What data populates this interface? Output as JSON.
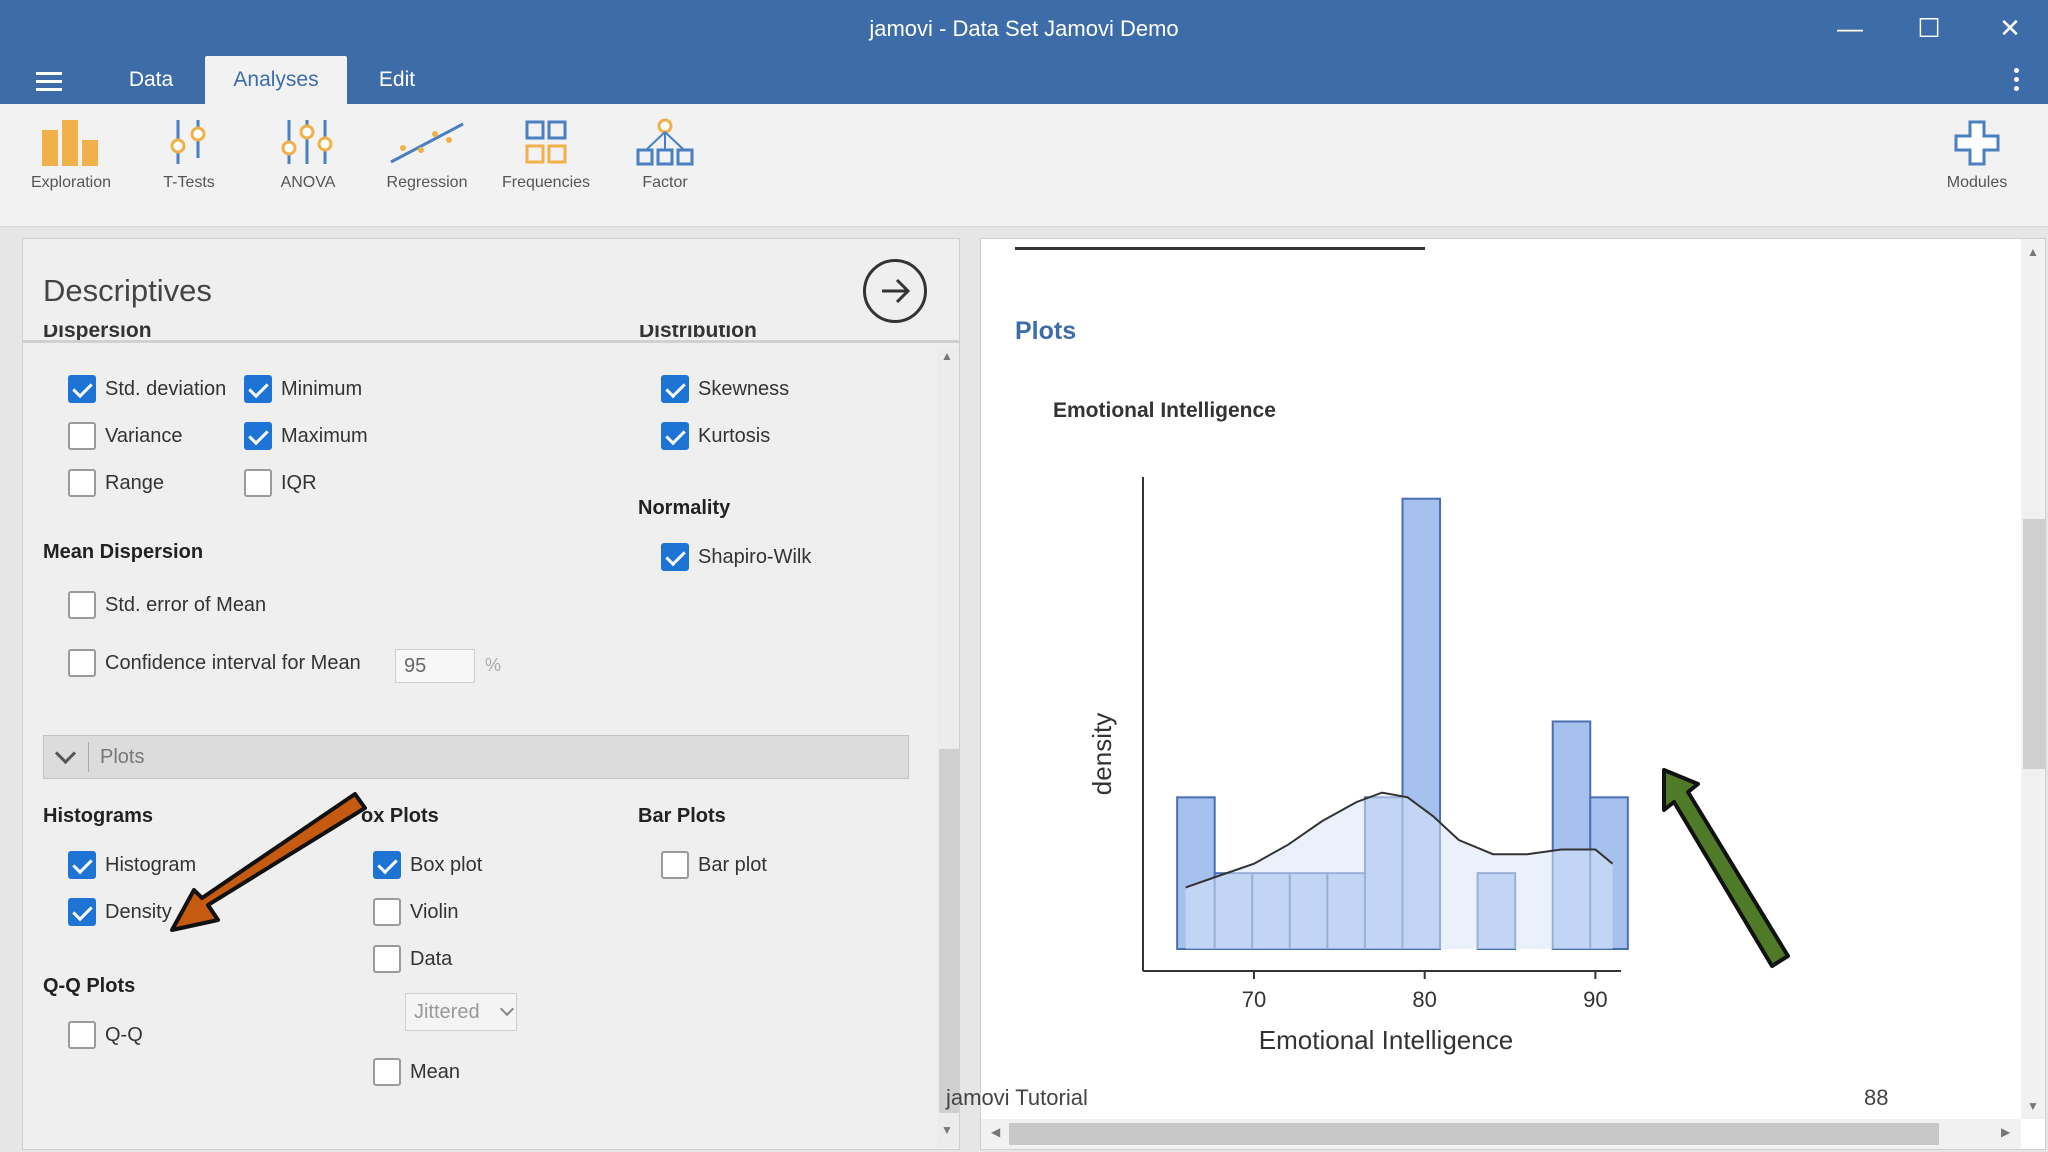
{
  "window": {
    "title": "jamovi - Data Set Jamovi Demo",
    "minimize": "—",
    "maximize": "☐",
    "close": "✕"
  },
  "menu": {
    "tabs": [
      {
        "label": "Data"
      },
      {
        "label": "Analyses"
      },
      {
        "label": "Edit"
      }
    ]
  },
  "ribbon": {
    "items": [
      {
        "label": "Exploration"
      },
      {
        "label": "T-Tests"
      },
      {
        "label": "ANOVA"
      },
      {
        "label": "Regression"
      },
      {
        "label": "Frequencies"
      },
      {
        "label": "Factor"
      }
    ],
    "modules": {
      "label": "Modules"
    }
  },
  "options": {
    "title": "Descriptives",
    "cut_headers": {
      "dispersion": "Dispersion",
      "distribution": "Distribution"
    },
    "dispersion": [
      {
        "label": "Std. deviation",
        "checked": true
      },
      {
        "label": "Minimum",
        "checked": true
      },
      {
        "label": "Variance",
        "checked": false
      },
      {
        "label": "Maximum",
        "checked": true
      },
      {
        "label": "Range",
        "checked": false
      },
      {
        "label": "IQR",
        "checked": false
      }
    ],
    "distribution": [
      {
        "label": "Skewness",
        "checked": true
      },
      {
        "label": "Kurtosis",
        "checked": true
      }
    ],
    "normality": {
      "title": "Normality",
      "items": [
        {
          "label": "Shapiro-Wilk",
          "checked": true
        }
      ]
    },
    "mean_dispersion": {
      "title": "Mean Dispersion",
      "items": [
        {
          "label": "Std. error of Mean",
          "checked": false
        },
        {
          "label": "Confidence interval for Mean",
          "checked": false
        }
      ],
      "ci_value": "95",
      "ci_unit": "%"
    },
    "plots_section": {
      "label": "Plots"
    },
    "histograms": {
      "title": "Histograms",
      "items": [
        {
          "label": "Histogram",
          "checked": true
        },
        {
          "label": "Density",
          "checked": true
        }
      ]
    },
    "box_plots": {
      "title": "ox Plots",
      "items": [
        {
          "label": "Box plot",
          "checked": true
        },
        {
          "label": "Violin",
          "checked": false
        },
        {
          "label": "Data",
          "checked": false
        },
        {
          "label": "Mean",
          "checked": false
        }
      ],
      "data_mode": "Jittered"
    },
    "bar_plots": {
      "title": "Bar Plots",
      "items": [
        {
          "label": "Bar plot",
          "checked": false
        }
      ]
    },
    "qq_plots": {
      "title": "Q-Q Plots",
      "items": [
        {
          "label": "Q-Q",
          "checked": false
        }
      ]
    }
  },
  "results": {
    "section_title": "Plots",
    "chart_title": "Emotional Intelligence"
  },
  "chart_data": {
    "type": "bar",
    "title": "Emotional Intelligence",
    "xlabel": "Emotional Intelligence",
    "ylabel": "density",
    "xticks": [
      70,
      80,
      90
    ],
    "xlim": [
      63.5,
      91.5
    ],
    "ylim": [
      0,
      1
    ],
    "bins": [
      {
        "x0": 65.5,
        "x1": 67.7,
        "value": 0.32
      },
      {
        "x0": 67.7,
        "x1": 69.9,
        "value": 0.16
      },
      {
        "x0": 69.9,
        "x1": 72.1,
        "value": 0.16
      },
      {
        "x0": 72.1,
        "x1": 74.3,
        "value": 0.16
      },
      {
        "x0": 74.3,
        "x1": 76.5,
        "value": 0.16
      },
      {
        "x0": 76.5,
        "x1": 78.7,
        "value": 0.32
      },
      {
        "x0": 78.7,
        "x1": 80.9,
        "value": 0.95
      },
      {
        "x0": 80.9,
        "x1": 83.1,
        "value": 0
      },
      {
        "x0": 83.1,
        "x1": 85.3,
        "value": 0.16
      },
      {
        "x0": 85.3,
        "x1": 87.5,
        "value": 0
      },
      {
        "x0": 87.5,
        "x1": 89.7,
        "value": 0.48
      },
      {
        "x0": 89.7,
        "x1": 91.9,
        "value": 0.32
      }
    ],
    "density_curve": {
      "x": [
        66,
        68,
        70,
        72,
        74,
        76,
        77.5,
        79,
        80.5,
        82,
        84,
        86,
        88,
        90,
        91
      ],
      "y": [
        0.13,
        0.155,
        0.18,
        0.22,
        0.27,
        0.31,
        0.33,
        0.32,
        0.28,
        0.23,
        0.2,
        0.2,
        0.21,
        0.21,
        0.18
      ]
    },
    "bar_color": "#a7c1ef",
    "bar_edge": "#4a6fb0",
    "density_fill": "#dbe5f7"
  },
  "annotations": {
    "watermark": "jamovi Tutorial",
    "page_number": "88",
    "orange_arrow_color": "#c55a11",
    "green_arrow_color": "#4f7a28"
  }
}
